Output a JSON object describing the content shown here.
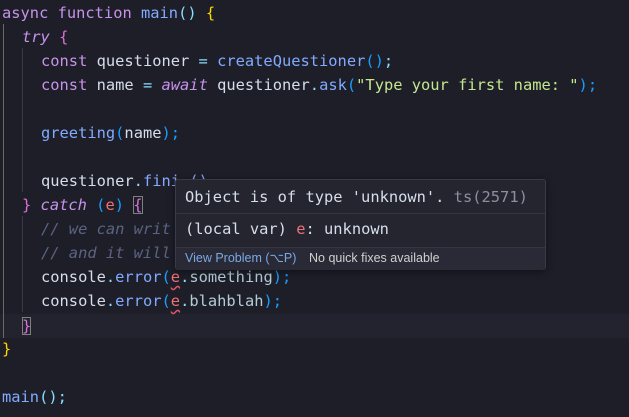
{
  "code": {
    "l1": {
      "kw": "async function ",
      "fn": "main",
      "rest": "() ",
      "brace": "{"
    },
    "l2": {
      "kw": "try",
      "brace": "{"
    },
    "l3": {
      "const": "const ",
      "var": "questioner",
      "eq": " = ",
      "fn": "createQuestioner",
      "paren": "()",
      "semi": ";"
    },
    "l4": {
      "const": "const ",
      "var": "name",
      "eq": " = ",
      "await": "await",
      "obj": " questioner",
      "dot": ".",
      "method": "ask",
      "open": "(",
      "str": "\"Type your first name: \"",
      "close": ");"
    },
    "l6": {
      "fn": "greeting",
      "open": "(",
      "arg": "name",
      "close": ");"
    },
    "l8": {
      "obj": "questioner",
      "dot": ".",
      "method": "fin",
      "tail": "i…()"
    },
    "l9": {
      "close": "} ",
      "kw": "catch",
      "open": " (",
      "param": "e",
      "close2": ") ",
      "brace": "{"
    },
    "l10": {
      "comment": "// we can writ"
    },
    "l11": {
      "comment": "// and it will"
    },
    "l12": {
      "obj": "console",
      "dot": ".",
      "method": "error",
      "open": "(",
      "param": "e",
      "dot2": ".",
      "prop": "something",
      "close": ");"
    },
    "l13": {
      "obj": "console",
      "dot": ".",
      "method": "error",
      "open": "(",
      "param": "e",
      "dot2": ".",
      "prop": "blahblah",
      "close": ");"
    },
    "l14": {
      "brace": "}"
    },
    "l15": {
      "brace": "}"
    },
    "l17": {
      "fn": "main",
      "rest": "();"
    }
  },
  "hover": {
    "message": "Object is of type 'unknown'.",
    "code": " ts(2571)",
    "signature_prefix": "(local var) ",
    "signature_name": "e",
    "signature_type": ": unknown",
    "view_problem": "View Problem (⌥P)",
    "no_fixes": "No quick fixes available"
  },
  "colors": {
    "background": "#1e1e29",
    "keyword": "#c792ea",
    "function": "#82aaff",
    "string": "#c3e88d",
    "comment": "#5a6480",
    "error_squiggle": "#e05561"
  }
}
